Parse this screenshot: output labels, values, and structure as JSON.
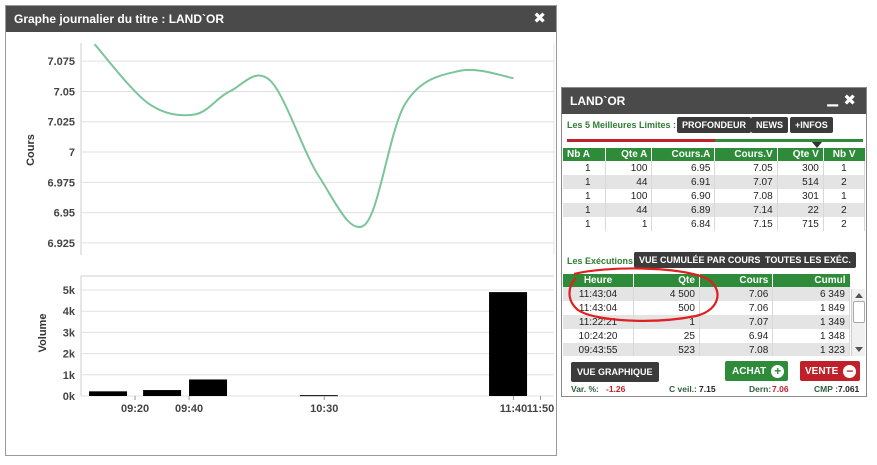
{
  "chart_window": {
    "title": "Graphe journalier du titre : LAND`OR"
  },
  "chart_data": [
    {
      "type": "line",
      "ylabel": "Cours",
      "y_ticks": [
        "7.075",
        "7.05",
        "7.025",
        "7",
        "6.975",
        "6.95",
        "6.925"
      ],
      "ylim": [
        6.915,
        7.09
      ],
      "x": [
        "09:05",
        "09:25",
        "09:42",
        "09:55",
        "10:10",
        "10:28",
        "10:45",
        "11:00",
        "11:20",
        "11:40"
      ],
      "series": [
        {
          "values": [
            7.089,
            7.04,
            7.031,
            7.05,
            7.059,
            6.98,
            6.94,
            7.04,
            7.067,
            7.061
          ]
        }
      ],
      "color": "#7cc49a",
      "grid": true
    },
    {
      "type": "bar",
      "ylabel": "Volume",
      "y_ticks": [
        "5k",
        "4k",
        "3k",
        "2k",
        "1k",
        "0k"
      ],
      "ylim": [
        0,
        5000
      ],
      "x_ticks": [
        "09:20",
        "09:40",
        "10:30",
        "11:40",
        "11:50"
      ],
      "categories": [
        "09:10",
        "09:30",
        "09:47",
        "10:28",
        "11:38"
      ],
      "values": [
        220,
        280,
        780,
        40,
        4900
      ],
      "color": "#000000",
      "grid": true
    }
  ],
  "panel": {
    "title": "LAND`OR",
    "limites_label": "Les 5 Meilleures Limites :",
    "btn_profondeur": "PROFONDEUR",
    "btn_news": "NEWS",
    "btn_infos": "+INFOS",
    "orderbook": {
      "headers": [
        "Nb A",
        "Qte A",
        "Cours.A",
        "Cours.V",
        "Qte V",
        "Nb V"
      ],
      "rows": [
        [
          "1",
          "100",
          "6.95",
          "7.05",
          "300",
          "1"
        ],
        [
          "1",
          "44",
          "6.91",
          "7.07",
          "514",
          "2"
        ],
        [
          "1",
          "100",
          "6.90",
          "7.08",
          "301",
          "1"
        ],
        [
          "1",
          "44",
          "6.89",
          "7.14",
          "22",
          "2"
        ],
        [
          "1",
          "1",
          "6.84",
          "7.15",
          "715",
          "2"
        ]
      ]
    },
    "executions_label": "Les Exécutions:",
    "btn_vue_cumulee": "VUE CUMULÉE PAR COURS",
    "btn_toutes": "TOUTES LES EXÉC.",
    "executions": {
      "headers": [
        "Heure",
        "Qte",
        "Cours",
        "Cumul"
      ],
      "rows": [
        [
          "11:43:04",
          "4 500",
          "7.06",
          "6 349"
        ],
        [
          "11:43:04",
          "500",
          "7.06",
          "1 849"
        ],
        [
          "11:22:21",
          "1",
          "7.07",
          "1 349"
        ],
        [
          "10:24:20",
          "25",
          "6.94",
          "1 348"
        ],
        [
          "09:43:55",
          "523",
          "7.08",
          "1 323"
        ]
      ]
    },
    "btn_vue_graphique": "VUE GRAPHIQUE",
    "btn_achat": "ACHAT",
    "btn_vente": "VENTE",
    "footer": {
      "var_label": "Var. %:",
      "var_value": "-1.26",
      "cveil_label": "C veil.:",
      "cveil_value": "7.15",
      "dern_label": "Dern:",
      "dern_value": "7.06",
      "cmp_label": "CMP :",
      "cmp_value": "7.061"
    },
    "colors": {
      "green": "#2e8b3a",
      "red": "#c0202a",
      "dark": "#3b3b3b"
    }
  }
}
